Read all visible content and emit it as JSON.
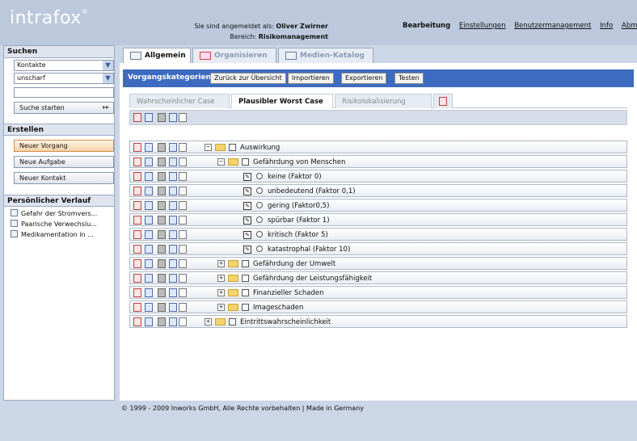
{
  "logo": {
    "text": "intrafox",
    "mark": "®"
  },
  "login": {
    "prefix": "Sie sind angemeldet als:",
    "user": "Oliver Zwirner",
    "area_prefix": "Bereich:",
    "area": "Risikomanagement"
  },
  "topnav": [
    "Bearbeitung",
    "Einstellungen",
    "Benutzermanagement",
    "Info",
    "Abmelden"
  ],
  "sidebar": {
    "search": {
      "title": "Suchen",
      "select1": "Kontakte",
      "select2": "unscharf",
      "input_value": "",
      "button": "Suche starten",
      "button_arrow": "▸▸"
    },
    "create": {
      "title": "Erstellen",
      "buttons": [
        "Neuer Vorgang",
        "Neue Aufgabe",
        "Neuer Kontakt"
      ]
    },
    "history": {
      "title": "Persönlicher Verlauf",
      "items": [
        "Gefahr der Stromvers...",
        "Paarische Verwechslu...",
        "Medikamentation in ..."
      ]
    }
  },
  "tabs": [
    "Allgemein",
    "Organisieren",
    "Medien-Katalog"
  ],
  "bluebar": {
    "label": "Vorgangskategorien",
    "buttons": [
      "Zurück zur Übersicht",
      "Importieren",
      "Exportieren",
      "Testen"
    ]
  },
  "subtabs": [
    "Wahrscheinlicher Case",
    "Plausibler Worst Case",
    "Risikolokalisierung"
  ],
  "tree": [
    {
      "label": "Auswirkung",
      "kind": "folder",
      "expanded": true,
      "level": 0
    },
    {
      "label": "Gefährdung von Menschen",
      "kind": "folder",
      "expanded": true,
      "level": 1
    },
    {
      "label": "keine (Faktor 0)",
      "kind": "option",
      "level": 2
    },
    {
      "label": "unbedeutend (Faktor 0,1)",
      "kind": "option",
      "level": 2
    },
    {
      "label": "gering (Faktor0,5)",
      "kind": "option",
      "level": 2
    },
    {
      "label": "spürbar (Faktor 1)",
      "kind": "option",
      "level": 2
    },
    {
      "label": "kritisch (Faktor 5)",
      "kind": "option",
      "level": 2
    },
    {
      "label": "katastrophal (Faktor 10)",
      "kind": "option",
      "level": 2
    },
    {
      "label": "Gefährdung der Umwelt",
      "kind": "folder",
      "expanded": false,
      "level": 1
    },
    {
      "label": "Gefährdung der Leistungsfähigkeit",
      "kind": "folder",
      "expanded": false,
      "level": 1
    },
    {
      "label": "Finanzieller Schaden",
      "kind": "folder",
      "expanded": false,
      "level": 1
    },
    {
      "label": "Imageschaden",
      "kind": "folder",
      "expanded": false,
      "level": 1
    },
    {
      "label": "Eintrittswahrscheinlichkeit",
      "kind": "folder",
      "expanded": false,
      "level": 0
    }
  ],
  "footer": "© 1999 - 2009 Inworks GmbH, Alle Rechte vorbehalten | Made in Germany"
}
